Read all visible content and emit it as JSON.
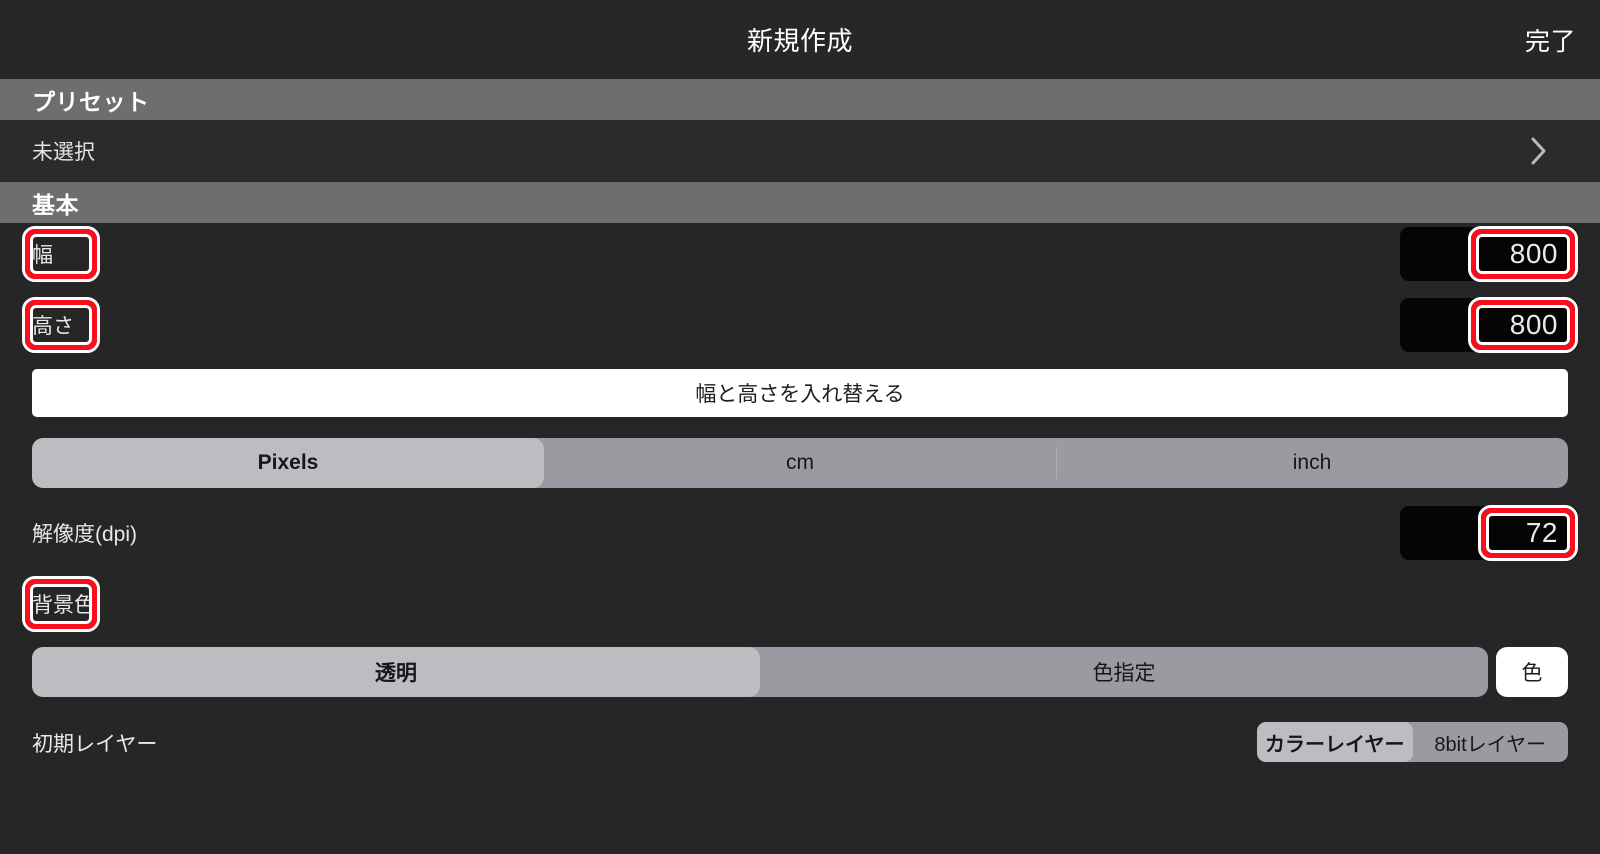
{
  "titlebar": {
    "title": "新規作成",
    "done_label": "完了"
  },
  "sections": {
    "preset_header": "プリセット",
    "basic_header": "基本"
  },
  "preset": {
    "value": "未選択",
    "chevron_icon": "chevron-right-icon"
  },
  "width": {
    "label": "幅",
    "value": "800"
  },
  "height": {
    "label": "高さ",
    "value": "800"
  },
  "swap": {
    "label": "幅と高さを入れ替える"
  },
  "units": {
    "options": [
      "Pixels",
      "cm",
      "inch"
    ],
    "selected": "Pixels"
  },
  "dpi": {
    "label": "解像度(dpi)",
    "value": "72"
  },
  "background": {
    "label": "背景色",
    "options": [
      "透明",
      "色指定"
    ],
    "selected": "透明",
    "color_button_label": "色"
  },
  "initial_layer": {
    "label": "初期レイヤー",
    "options": [
      "カラーレイヤー",
      "8bitレイヤー"
    ],
    "selected": "カラーレイヤー"
  },
  "colors": {
    "background": "#262626",
    "titlebar": "#272727",
    "section_header": "#6e6e6e",
    "row": "#2b2b2b",
    "input": "#050505",
    "highlight": "#fb0d1b",
    "segment_track": "#9a9aa0",
    "segment_selected": "#bcbcc1",
    "button_white": "#ffffff"
  }
}
